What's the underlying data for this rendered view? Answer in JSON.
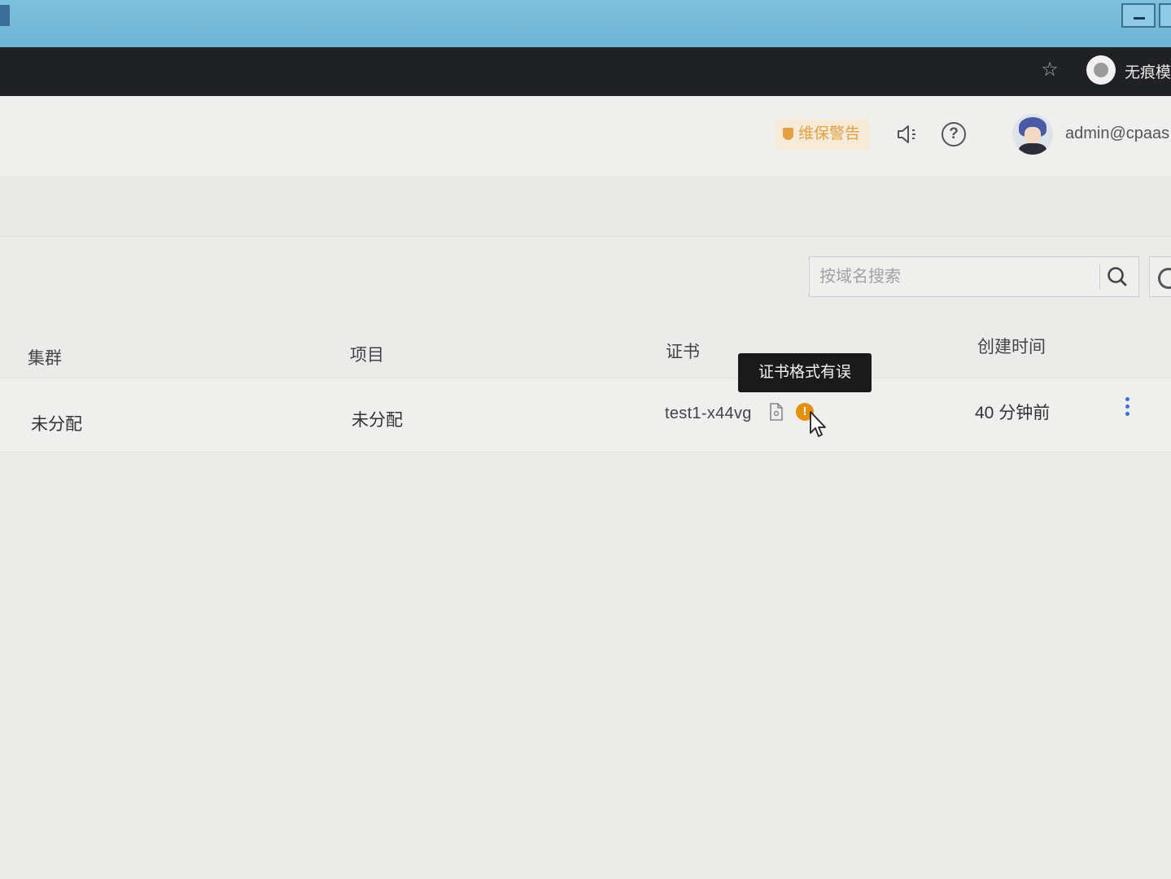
{
  "os": {
    "icons": [
      "minimize-icon",
      "close-icon"
    ]
  },
  "browser": {
    "profile_name": "无痕模"
  },
  "header": {
    "warning_label": "维保警告",
    "user_name": "admin@cpaas"
  },
  "search": {
    "placeholder": "按域名搜索"
  },
  "table": {
    "columns": [
      "集群",
      "项目",
      "证书",
      "创建时间"
    ],
    "rows": [
      {
        "cluster": "未分配",
        "project": "未分配",
        "certificate": "test1-x44vg",
        "created": "40 分钟前"
      }
    ]
  },
  "tooltip": {
    "text": "证书格式有误"
  },
  "colors": {
    "warning": "#e3a043",
    "error_badge": "#e3910f",
    "action_blue": "#3a6fd8",
    "browser_bar": "#1f2124"
  }
}
